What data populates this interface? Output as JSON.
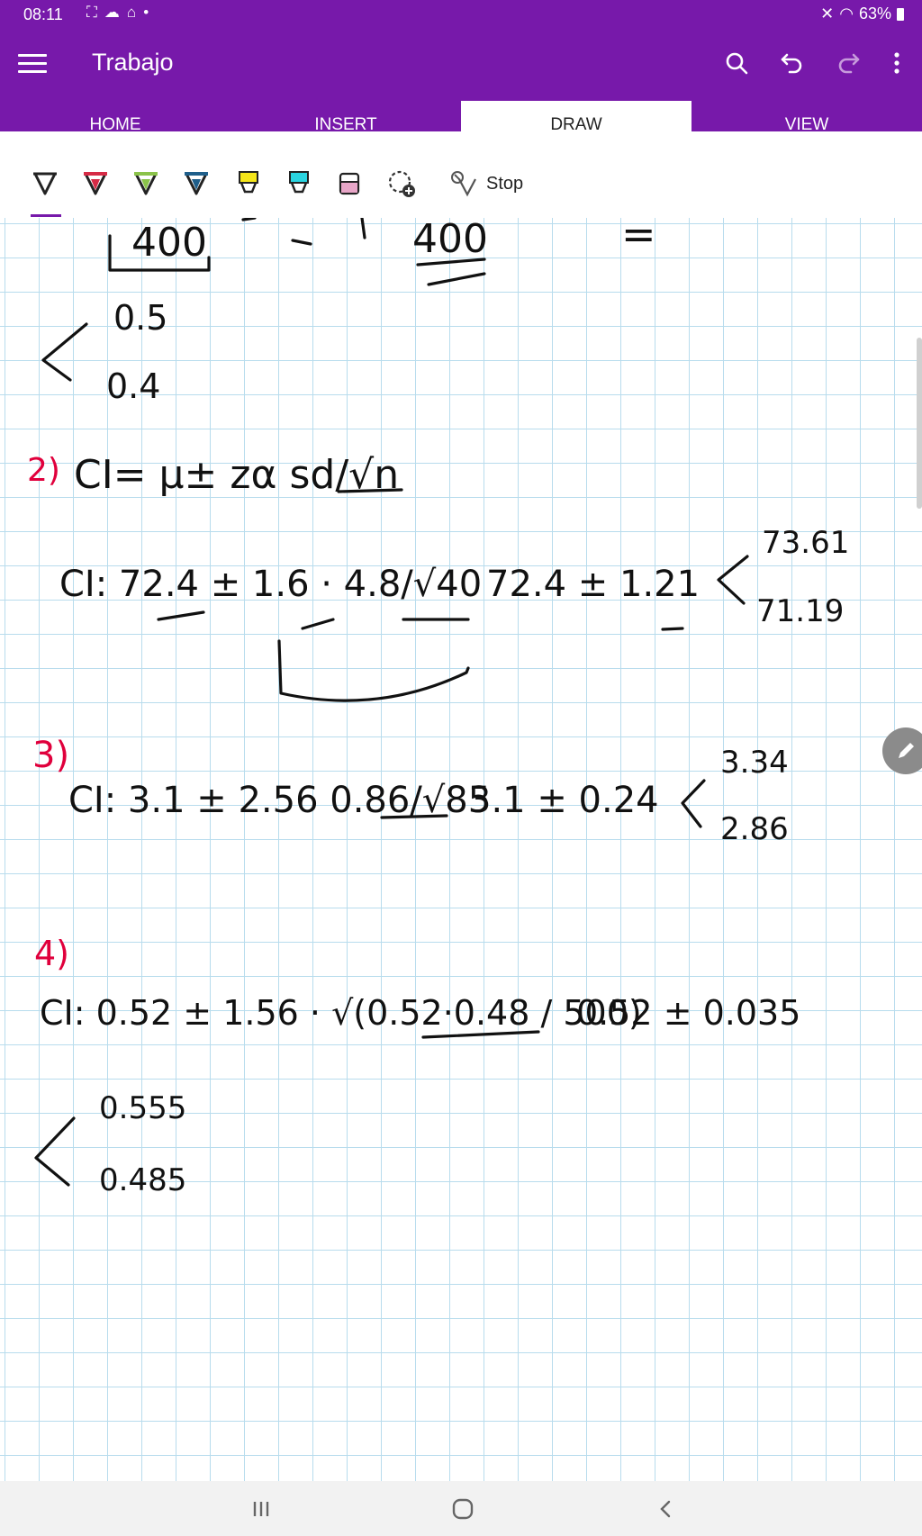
{
  "status": {
    "time": "08:11",
    "battery": "63%"
  },
  "app": {
    "title": "Trabajo",
    "accent": "#7719aa"
  },
  "tabs": [
    {
      "label": "HOME",
      "active": false
    },
    {
      "label": "INSERT",
      "active": false
    },
    {
      "label": "DRAW",
      "active": true
    },
    {
      "label": "VIEW",
      "active": false
    }
  ],
  "ribbon": {
    "stop_label": "Stop",
    "tools": [
      {
        "name": "pen-black",
        "color": "#222222"
      },
      {
        "name": "pen-red",
        "color": "#d62b46"
      },
      {
        "name": "pen-green",
        "color": "#8bc34a"
      },
      {
        "name": "pen-blue",
        "color": "#1f5f8b"
      },
      {
        "name": "highlighter-yellow",
        "color": "#f5e61a"
      },
      {
        "name": "highlighter-cyan",
        "color": "#2ad4e0"
      },
      {
        "name": "highlighter-pink",
        "color": "#e8a6c8"
      },
      {
        "name": "lasso-add",
        "color": "#333333"
      }
    ]
  },
  "notes": {
    "top": {
      "frac1": "400",
      "frac2": "400",
      "eq": "=",
      "upper": "0.5",
      "lower": "0.4"
    },
    "q2": {
      "number": "2)",
      "formula": "CI= μ± zα sd/√n",
      "left": "CI: 72.4 ± 1.6 · 4.8/√40",
      "middle": "72.4 ± 1.21",
      "upper": "73.61",
      "lower": "71.19"
    },
    "q3": {
      "number": "3)",
      "left": "CI: 3.1 ± 2.56 0.86/√85",
      "middle": "3.1 ± 0.24",
      "upper": "3.34",
      "lower": "2.86"
    },
    "q4": {
      "number": "4)",
      "left": "CI: 0.52 ± 1.56 · √(0.52·0.48 / 500)",
      "middle": "0.52 ± 0.035",
      "upper": "0.555",
      "lower": "0.485"
    }
  }
}
